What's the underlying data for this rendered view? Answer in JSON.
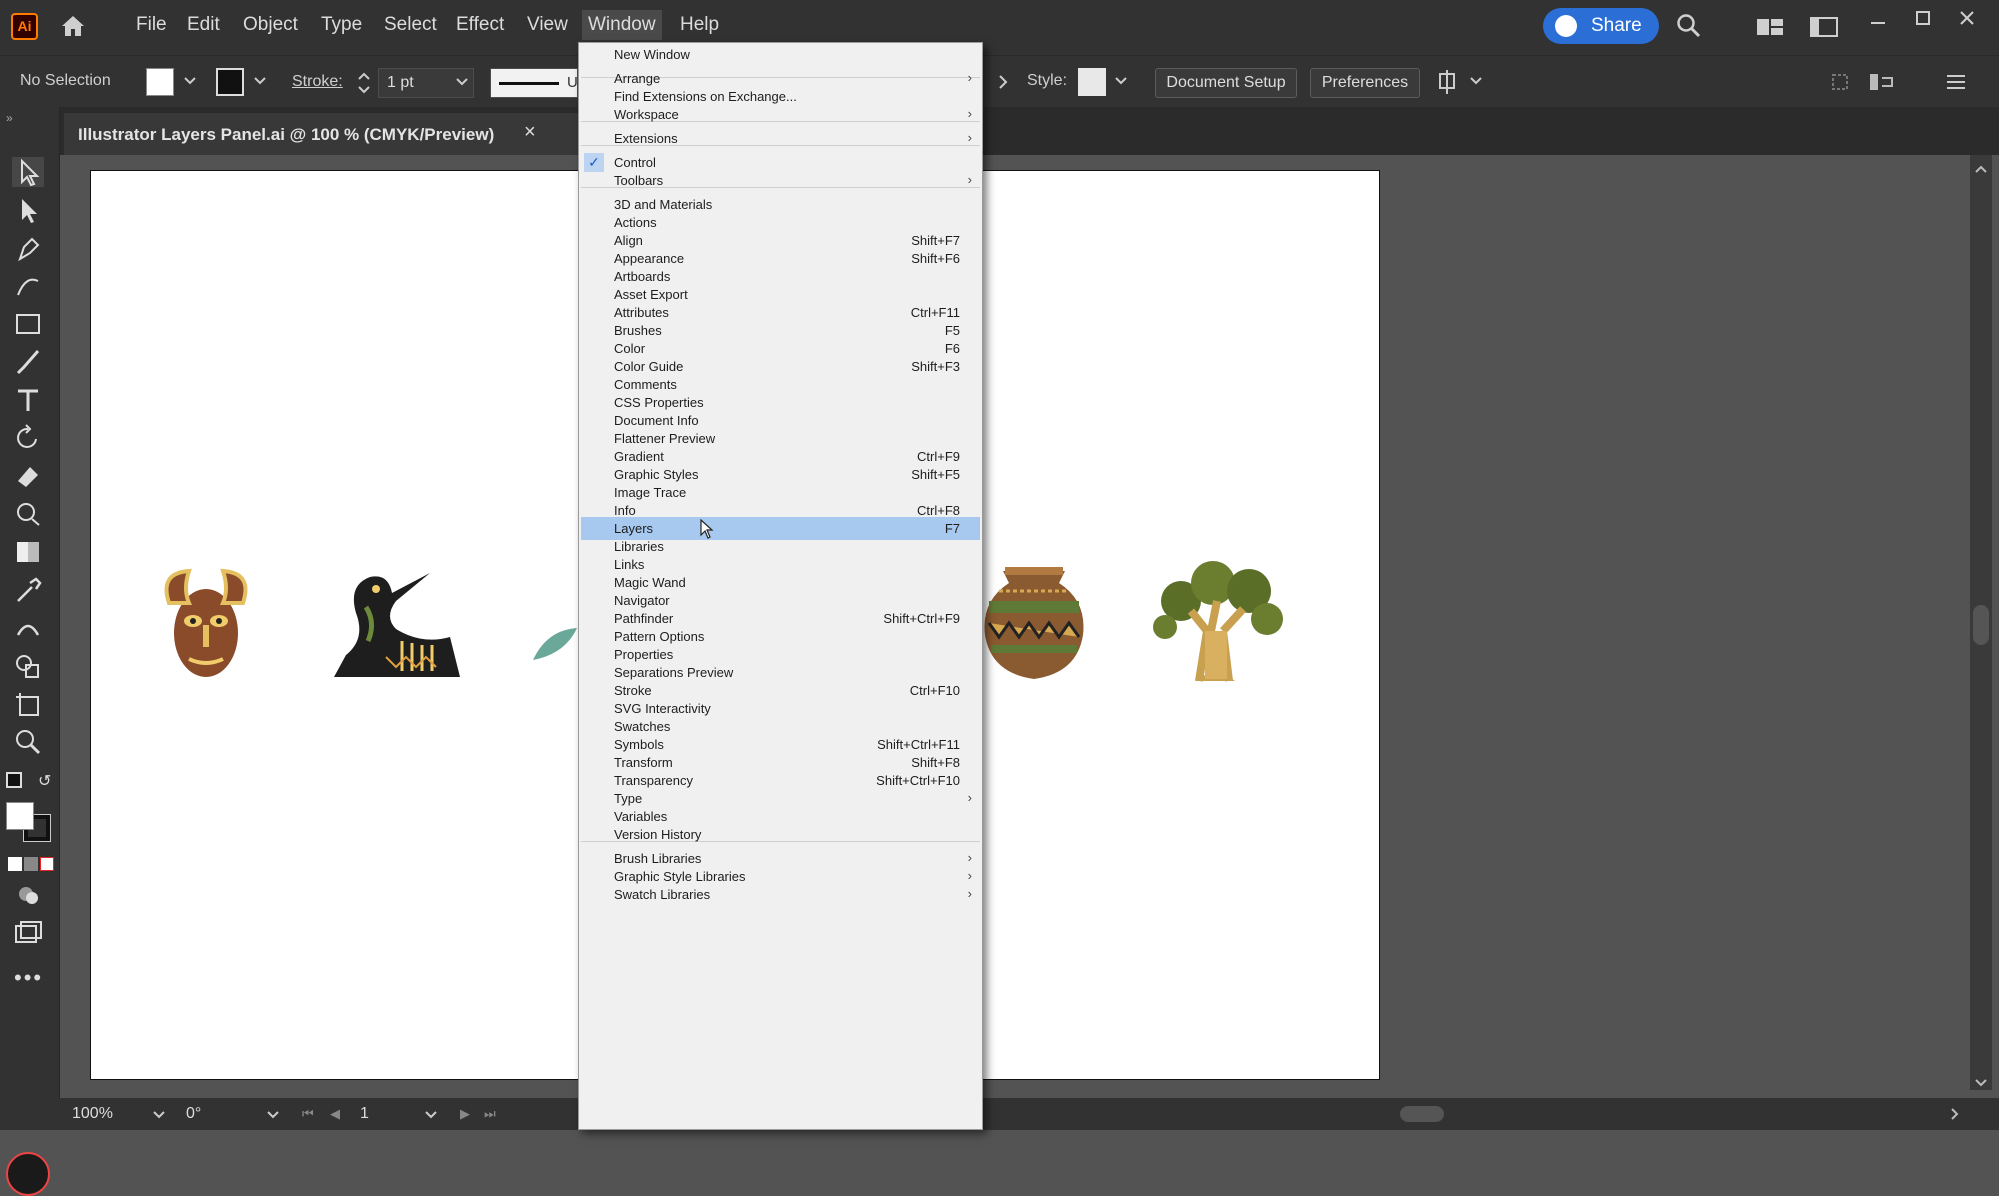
{
  "app": {
    "logo": "Ai"
  },
  "menubar": {
    "items": [
      "File",
      "Edit",
      "Object",
      "Type",
      "Select",
      "Effect",
      "View",
      "Window",
      "Help"
    ],
    "share_label": "Share"
  },
  "control": {
    "selection": "No Selection",
    "stroke_label": "Stroke:",
    "stroke_weight": "1 pt",
    "style_label": "Style:",
    "document_setup": "Document Setup",
    "preferences": "Preferences",
    "uniform_partial": "U"
  },
  "document": {
    "tab_title": "Illustrator Layers Panel.ai @ 100 % (CMYK/Preview)",
    "close_glyph": "×"
  },
  "status": {
    "zoom": "100%",
    "rotation": "0°",
    "artboard_number": "1"
  },
  "window_menu": {
    "items": [
      {
        "label": "New Window",
        "shortcut": "",
        "submenu": false
      },
      {
        "label": "Arrange",
        "shortcut": "",
        "submenu": true
      },
      {
        "label": "Find Extensions on Exchange...",
        "shortcut": "",
        "submenu": false
      },
      {
        "label": "Workspace",
        "shortcut": "",
        "submenu": true
      },
      {
        "label": "Extensions",
        "shortcut": "",
        "submenu": true
      },
      {
        "label": "Control",
        "shortcut": "",
        "submenu": false,
        "checked": true
      },
      {
        "label": "Toolbars",
        "shortcut": "",
        "submenu": true
      },
      {
        "label": "3D and Materials",
        "shortcut": "",
        "submenu": false
      },
      {
        "label": "Actions",
        "shortcut": "",
        "submenu": false
      },
      {
        "label": "Align",
        "shortcut": "Shift+F7",
        "submenu": false
      },
      {
        "label": "Appearance",
        "shortcut": "Shift+F6",
        "submenu": false
      },
      {
        "label": "Artboards",
        "shortcut": "",
        "submenu": false
      },
      {
        "label": "Asset Export",
        "shortcut": "",
        "submenu": false
      },
      {
        "label": "Attributes",
        "shortcut": "Ctrl+F11",
        "submenu": false
      },
      {
        "label": "Brushes",
        "shortcut": "F5",
        "submenu": false
      },
      {
        "label": "Color",
        "shortcut": "F6",
        "submenu": false
      },
      {
        "label": "Color Guide",
        "shortcut": "Shift+F3",
        "submenu": false
      },
      {
        "label": "Comments",
        "shortcut": "",
        "submenu": false
      },
      {
        "label": "CSS Properties",
        "shortcut": "",
        "submenu": false
      },
      {
        "label": "Document Info",
        "shortcut": "",
        "submenu": false
      },
      {
        "label": "Flattener Preview",
        "shortcut": "",
        "submenu": false
      },
      {
        "label": "Gradient",
        "shortcut": "Ctrl+F9",
        "submenu": false
      },
      {
        "label": "Graphic Styles",
        "shortcut": "Shift+F5",
        "submenu": false
      },
      {
        "label": "Image Trace",
        "shortcut": "",
        "submenu": false
      },
      {
        "label": "Info",
        "shortcut": "Ctrl+F8",
        "submenu": false
      },
      {
        "label": "Layers",
        "shortcut": "F7",
        "submenu": false,
        "highlighted": true
      },
      {
        "label": "Libraries",
        "shortcut": "",
        "submenu": false
      },
      {
        "label": "Links",
        "shortcut": "",
        "submenu": false
      },
      {
        "label": "Magic Wand",
        "shortcut": "",
        "submenu": false
      },
      {
        "label": "Navigator",
        "shortcut": "",
        "submenu": false
      },
      {
        "label": "Pathfinder",
        "shortcut": "Shift+Ctrl+F9",
        "submenu": false
      },
      {
        "label": "Pattern Options",
        "shortcut": "",
        "submenu": false
      },
      {
        "label": "Properties",
        "shortcut": "",
        "submenu": false
      },
      {
        "label": "Separations Preview",
        "shortcut": "",
        "submenu": false
      },
      {
        "label": "Stroke",
        "shortcut": "Ctrl+F10",
        "submenu": false
      },
      {
        "label": "SVG Interactivity",
        "shortcut": "",
        "submenu": false
      },
      {
        "label": "Swatches",
        "shortcut": "",
        "submenu": false
      },
      {
        "label": "Symbols",
        "shortcut": "Shift+Ctrl+F11",
        "submenu": false
      },
      {
        "label": "Transform",
        "shortcut": "Shift+F8",
        "submenu": false
      },
      {
        "label": "Transparency",
        "shortcut": "Shift+Ctrl+F10",
        "submenu": false
      },
      {
        "label": "Type",
        "shortcut": "",
        "submenu": true
      },
      {
        "label": "Variables",
        "shortcut": "",
        "submenu": false
      },
      {
        "label": "Version History",
        "shortcut": "",
        "submenu": false
      },
      {
        "label": "Brush Libraries",
        "shortcut": "",
        "submenu": true
      },
      {
        "label": "Graphic Style Libraries",
        "shortcut": "",
        "submenu": true
      },
      {
        "label": "Swatch Libraries",
        "shortcut": "",
        "submenu": true
      }
    ]
  },
  "colors": {
    "accent": "#2b6fd6",
    "menu_highlight": "#a7c9ef",
    "logo_orange": "#ff7c00"
  }
}
